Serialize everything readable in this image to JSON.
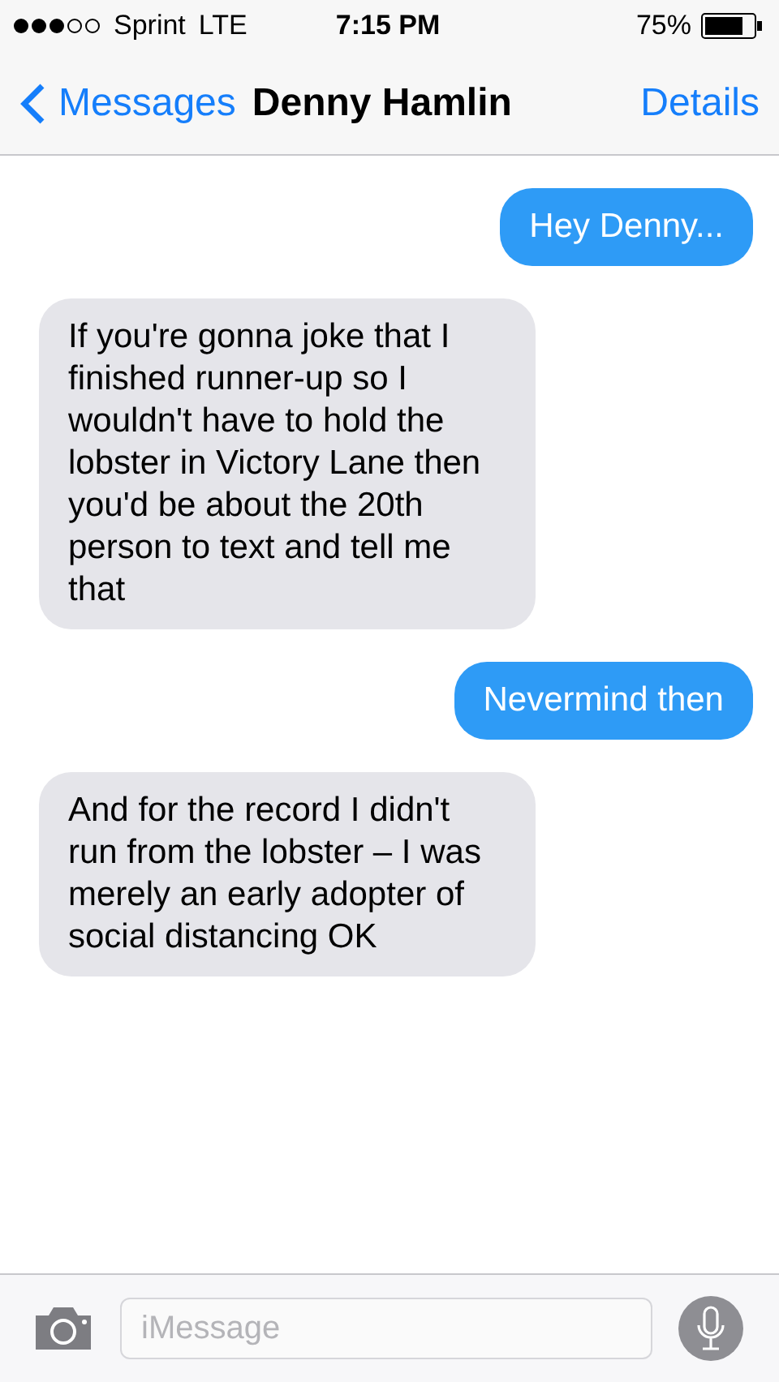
{
  "status_bar": {
    "carrier": "Sprint",
    "network": "LTE",
    "time": "7:15 PM",
    "battery": "75%"
  },
  "nav": {
    "back": "Messages",
    "title": "Denny Hamlin",
    "action": "Details"
  },
  "messages": [
    {
      "kind": "sent",
      "text": "Hey Denny..."
    },
    {
      "kind": "received",
      "text": "If you're gonna joke that I finished runner-up so I wouldn't have to hold the lobster in Victory Lane then you'd be about the 20th person to text and tell me that"
    },
    {
      "kind": "sent",
      "text": "Nevermind then"
    },
    {
      "kind": "received",
      "text": "And for the record I didn't run from the lobster – I was merely an early adopter of social distancing OK"
    }
  ],
  "composer": {
    "placeholder": "iMessage"
  }
}
